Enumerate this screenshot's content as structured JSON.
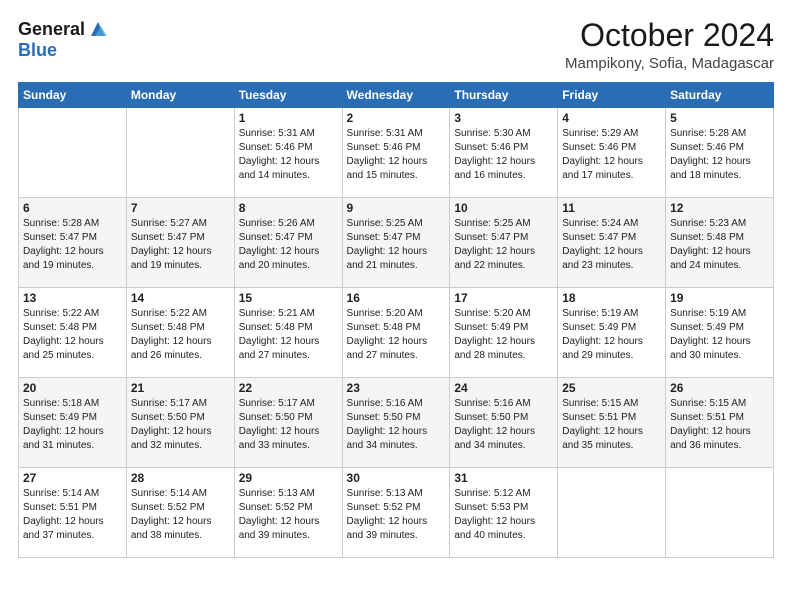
{
  "logo": {
    "general": "General",
    "blue": "Blue"
  },
  "title": "October 2024",
  "subtitle": "Mampikony, Sofia, Madagascar",
  "days": [
    "Sunday",
    "Monday",
    "Tuesday",
    "Wednesday",
    "Thursday",
    "Friday",
    "Saturday"
  ],
  "weeks": [
    [
      {
        "day": "",
        "sunrise": "",
        "sunset": "",
        "daylight": ""
      },
      {
        "day": "",
        "sunrise": "",
        "sunset": "",
        "daylight": ""
      },
      {
        "day": "1",
        "sunrise": "Sunrise: 5:31 AM",
        "sunset": "Sunset: 5:46 PM",
        "daylight": "Daylight: 12 hours and 14 minutes."
      },
      {
        "day": "2",
        "sunrise": "Sunrise: 5:31 AM",
        "sunset": "Sunset: 5:46 PM",
        "daylight": "Daylight: 12 hours and 15 minutes."
      },
      {
        "day": "3",
        "sunrise": "Sunrise: 5:30 AM",
        "sunset": "Sunset: 5:46 PM",
        "daylight": "Daylight: 12 hours and 16 minutes."
      },
      {
        "day": "4",
        "sunrise": "Sunrise: 5:29 AM",
        "sunset": "Sunset: 5:46 PM",
        "daylight": "Daylight: 12 hours and 17 minutes."
      },
      {
        "day": "5",
        "sunrise": "Sunrise: 5:28 AM",
        "sunset": "Sunset: 5:46 PM",
        "daylight": "Daylight: 12 hours and 18 minutes."
      }
    ],
    [
      {
        "day": "6",
        "sunrise": "Sunrise: 5:28 AM",
        "sunset": "Sunset: 5:47 PM",
        "daylight": "Daylight: 12 hours and 19 minutes."
      },
      {
        "day": "7",
        "sunrise": "Sunrise: 5:27 AM",
        "sunset": "Sunset: 5:47 PM",
        "daylight": "Daylight: 12 hours and 19 minutes."
      },
      {
        "day": "8",
        "sunrise": "Sunrise: 5:26 AM",
        "sunset": "Sunset: 5:47 PM",
        "daylight": "Daylight: 12 hours and 20 minutes."
      },
      {
        "day": "9",
        "sunrise": "Sunrise: 5:25 AM",
        "sunset": "Sunset: 5:47 PM",
        "daylight": "Daylight: 12 hours and 21 minutes."
      },
      {
        "day": "10",
        "sunrise": "Sunrise: 5:25 AM",
        "sunset": "Sunset: 5:47 PM",
        "daylight": "Daylight: 12 hours and 22 minutes."
      },
      {
        "day": "11",
        "sunrise": "Sunrise: 5:24 AM",
        "sunset": "Sunset: 5:47 PM",
        "daylight": "Daylight: 12 hours and 23 minutes."
      },
      {
        "day": "12",
        "sunrise": "Sunrise: 5:23 AM",
        "sunset": "Sunset: 5:48 PM",
        "daylight": "Daylight: 12 hours and 24 minutes."
      }
    ],
    [
      {
        "day": "13",
        "sunrise": "Sunrise: 5:22 AM",
        "sunset": "Sunset: 5:48 PM",
        "daylight": "Daylight: 12 hours and 25 minutes."
      },
      {
        "day": "14",
        "sunrise": "Sunrise: 5:22 AM",
        "sunset": "Sunset: 5:48 PM",
        "daylight": "Daylight: 12 hours and 26 minutes."
      },
      {
        "day": "15",
        "sunrise": "Sunrise: 5:21 AM",
        "sunset": "Sunset: 5:48 PM",
        "daylight": "Daylight: 12 hours and 27 minutes."
      },
      {
        "day": "16",
        "sunrise": "Sunrise: 5:20 AM",
        "sunset": "Sunset: 5:48 PM",
        "daylight": "Daylight: 12 hours and 27 minutes."
      },
      {
        "day": "17",
        "sunrise": "Sunrise: 5:20 AM",
        "sunset": "Sunset: 5:49 PM",
        "daylight": "Daylight: 12 hours and 28 minutes."
      },
      {
        "day": "18",
        "sunrise": "Sunrise: 5:19 AM",
        "sunset": "Sunset: 5:49 PM",
        "daylight": "Daylight: 12 hours and 29 minutes."
      },
      {
        "day": "19",
        "sunrise": "Sunrise: 5:19 AM",
        "sunset": "Sunset: 5:49 PM",
        "daylight": "Daylight: 12 hours and 30 minutes."
      }
    ],
    [
      {
        "day": "20",
        "sunrise": "Sunrise: 5:18 AM",
        "sunset": "Sunset: 5:49 PM",
        "daylight": "Daylight: 12 hours and 31 minutes."
      },
      {
        "day": "21",
        "sunrise": "Sunrise: 5:17 AM",
        "sunset": "Sunset: 5:50 PM",
        "daylight": "Daylight: 12 hours and 32 minutes."
      },
      {
        "day": "22",
        "sunrise": "Sunrise: 5:17 AM",
        "sunset": "Sunset: 5:50 PM",
        "daylight": "Daylight: 12 hours and 33 minutes."
      },
      {
        "day": "23",
        "sunrise": "Sunrise: 5:16 AM",
        "sunset": "Sunset: 5:50 PM",
        "daylight": "Daylight: 12 hours and 34 minutes."
      },
      {
        "day": "24",
        "sunrise": "Sunrise: 5:16 AM",
        "sunset": "Sunset: 5:50 PM",
        "daylight": "Daylight: 12 hours and 34 minutes."
      },
      {
        "day": "25",
        "sunrise": "Sunrise: 5:15 AM",
        "sunset": "Sunset: 5:51 PM",
        "daylight": "Daylight: 12 hours and 35 minutes."
      },
      {
        "day": "26",
        "sunrise": "Sunrise: 5:15 AM",
        "sunset": "Sunset: 5:51 PM",
        "daylight": "Daylight: 12 hours and 36 minutes."
      }
    ],
    [
      {
        "day": "27",
        "sunrise": "Sunrise: 5:14 AM",
        "sunset": "Sunset: 5:51 PM",
        "daylight": "Daylight: 12 hours and 37 minutes."
      },
      {
        "day": "28",
        "sunrise": "Sunrise: 5:14 AM",
        "sunset": "Sunset: 5:52 PM",
        "daylight": "Daylight: 12 hours and 38 minutes."
      },
      {
        "day": "29",
        "sunrise": "Sunrise: 5:13 AM",
        "sunset": "Sunset: 5:52 PM",
        "daylight": "Daylight: 12 hours and 39 minutes."
      },
      {
        "day": "30",
        "sunrise": "Sunrise: 5:13 AM",
        "sunset": "Sunset: 5:52 PM",
        "daylight": "Daylight: 12 hours and 39 minutes."
      },
      {
        "day": "31",
        "sunrise": "Sunrise: 5:12 AM",
        "sunset": "Sunset: 5:53 PM",
        "daylight": "Daylight: 12 hours and 40 minutes."
      },
      {
        "day": "",
        "sunrise": "",
        "sunset": "",
        "daylight": ""
      },
      {
        "day": "",
        "sunrise": "",
        "sunset": "",
        "daylight": ""
      }
    ]
  ]
}
